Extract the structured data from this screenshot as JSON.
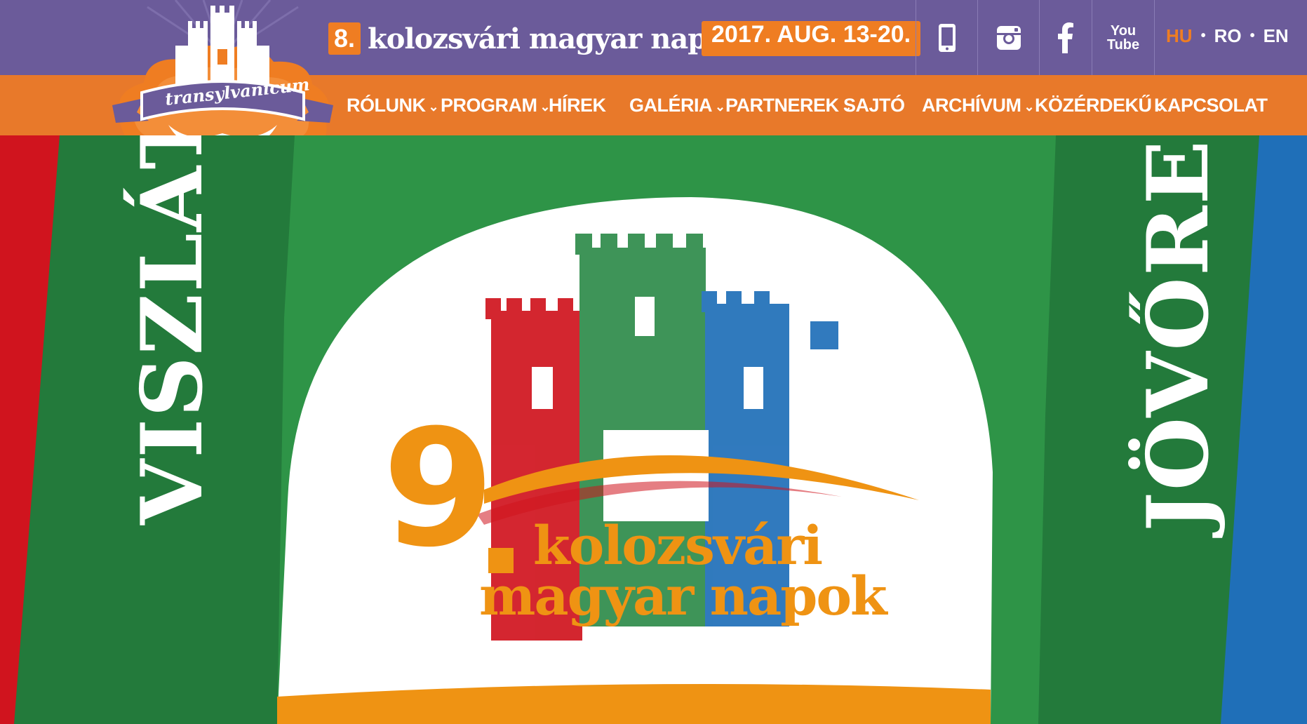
{
  "header": {
    "festival_number": "8.",
    "festival_name": "kolozsvári magyar napok",
    "festival_dates": "2017. AUG. 13-20.",
    "social": {
      "youtube_line1": "You",
      "youtube_line2": "Tube"
    },
    "languages": [
      {
        "code": "HU",
        "active": true
      },
      {
        "code": "RO",
        "active": false
      },
      {
        "code": "EN",
        "active": false
      }
    ],
    "separator": "•"
  },
  "logo": {
    "text": "transylvanicum"
  },
  "nav": {
    "items": [
      {
        "label": "RÓLUNK",
        "has_dropdown": true
      },
      {
        "label": "PROGRAM",
        "has_dropdown": true
      },
      {
        "label": "HÍREK",
        "has_dropdown": false
      },
      {
        "label": "GALÉRIA",
        "has_dropdown": true
      },
      {
        "label": "PARTNEREK",
        "has_dropdown": true
      },
      {
        "label": "SAJTÓ",
        "has_dropdown": false
      },
      {
        "label": "ARCHÍVUM",
        "has_dropdown": true
      },
      {
        "label": "KÖZÉRDEKŰ",
        "has_dropdown": true
      },
      {
        "label": "KAPCSOLAT",
        "has_dropdown": false
      }
    ],
    "chevron": "⌄"
  },
  "hero": {
    "left_text": "VISZLÁT",
    "right_text": "JÖVŐRE!",
    "next_number": "9",
    "next_line1": "kolozsvári",
    "next_line2": "magyar napok"
  },
  "colors": {
    "purple": "#6b5b9a",
    "orange": "#e8792a",
    "green": "#2e9447",
    "dark_green": "#237a3b",
    "red": "#d0141e",
    "blue": "#1f6fb8",
    "logo_orange": "#ef9313"
  },
  "icons": [
    "mobile-icon",
    "instagram-icon",
    "facebook-icon",
    "youtube-icon"
  ]
}
